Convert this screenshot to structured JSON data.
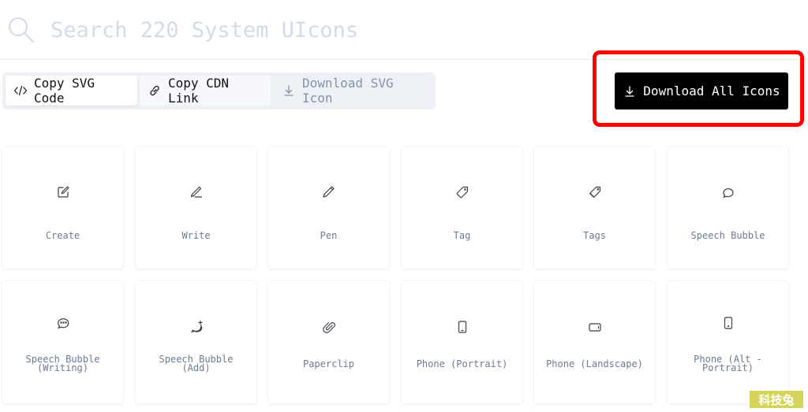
{
  "search": {
    "placeholder": "Search 220 System UIcons",
    "value": "",
    "icon": "search-icon"
  },
  "actions": {
    "copy_svg": {
      "label": "Copy SVG Code",
      "icon": "code-icon"
    },
    "copy_cdn": {
      "label": "Copy CDN Link",
      "icon": "link-icon"
    },
    "download_svg": {
      "label": "Download SVG Icon",
      "icon": "download-icon"
    }
  },
  "download_all": {
    "label": "Download All Icons",
    "icon": "download-icon"
  },
  "highlight_color": "#ff0000",
  "icons": [
    {
      "label": "Create",
      "icon": "create-icon"
    },
    {
      "label": "Write",
      "icon": "write-icon"
    },
    {
      "label": "Pen",
      "icon": "pen-icon"
    },
    {
      "label": "Tag",
      "icon": "tag-icon"
    },
    {
      "label": "Tags",
      "icon": "tags-icon"
    },
    {
      "label": "Speech Bubble",
      "icon": "speech-bubble-icon"
    },
    {
      "label": "Speech Bubble (Writing)",
      "icon": "speech-bubble-writing-icon"
    },
    {
      "label": "Speech Bubble (Add)",
      "icon": "speech-bubble-add-icon"
    },
    {
      "label": "Paperclip",
      "icon": "paperclip-icon"
    },
    {
      "label": "Phone (Portrait)",
      "icon": "phone-portrait-icon"
    },
    {
      "label": "Phone (Landscape)",
      "icon": "phone-landscape-icon"
    },
    {
      "label": "Phone (Alt - Portrait)",
      "icon": "phone-alt-portrait-icon"
    }
  ],
  "watermark": {
    "text": "科技兔"
  }
}
